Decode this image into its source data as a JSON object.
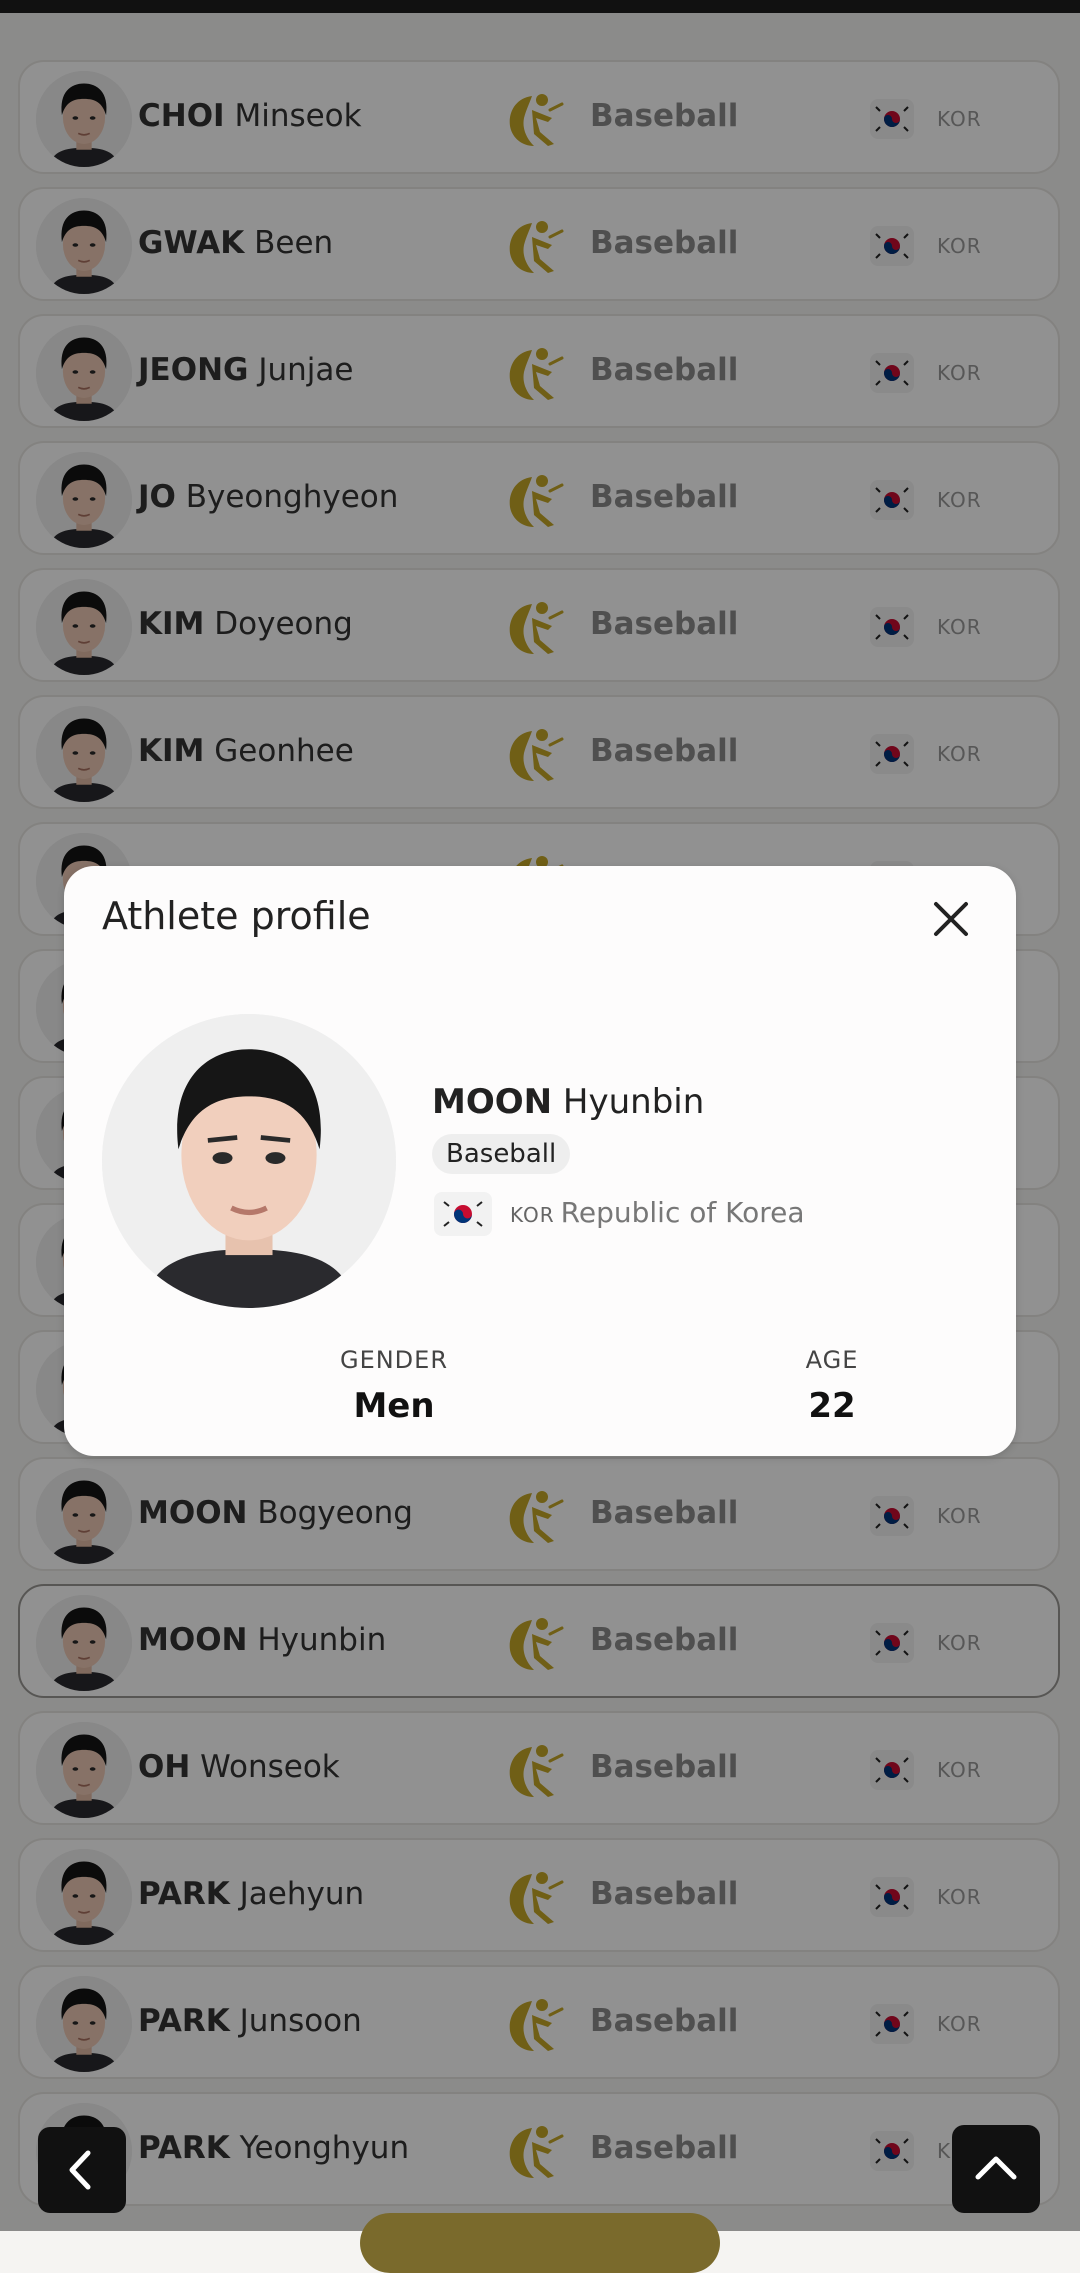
{
  "modal": {
    "title": "Athlete profile",
    "athlete": {
      "family_name": "MOON",
      "given_name": "Hyunbin",
      "sport": "Baseball",
      "noc": "KOR",
      "country": "Republic of Korea"
    },
    "stats": [
      {
        "label": "GENDER",
        "value": "Men"
      },
      {
        "label": "AGE",
        "value": "22"
      }
    ],
    "close_icon": "close-icon"
  },
  "list": {
    "rows": [
      {
        "family": "CHOI",
        "given": "Minseok",
        "sport": "Baseball",
        "noc": "KOR"
      },
      {
        "family": "GWAK",
        "given": "Been",
        "sport": "Baseball",
        "noc": "KOR"
      },
      {
        "family": "JEONG",
        "given": "Junjae",
        "sport": "Baseball",
        "noc": "KOR"
      },
      {
        "family": "JO",
        "given": "Byeonghyeon",
        "sport": "Baseball",
        "noc": "KOR"
      },
      {
        "family": "KIM",
        "given": "Doyeong",
        "sport": "Baseball",
        "noc": "KOR"
      },
      {
        "family": "KIM",
        "given": "Geonhee",
        "sport": "Baseball",
        "noc": "KOR"
      },
      {
        "family": "",
        "given": "",
        "sport": "",
        "noc": ""
      },
      {
        "family": "",
        "given": "",
        "sport": "",
        "noc": ""
      },
      {
        "family": "",
        "given": "",
        "sport": "",
        "noc": ""
      },
      {
        "family": "",
        "given": "",
        "sport": "",
        "noc": ""
      },
      {
        "family": "",
        "given": "",
        "sport": "",
        "noc": ""
      },
      {
        "family": "MOON",
        "given": "Bogyeong",
        "sport": "Baseball",
        "noc": "KOR"
      },
      {
        "family": "MOON",
        "given": "Hyunbin",
        "sport": "Baseball",
        "noc": "KOR",
        "selected": true
      },
      {
        "family": "OH",
        "given": "Wonseok",
        "sport": "Baseball",
        "noc": "KOR"
      },
      {
        "family": "PARK",
        "given": "Jaehyun",
        "sport": "Baseball",
        "noc": "KOR"
      },
      {
        "family": "PARK",
        "given": "Junsoon",
        "sport": "Baseball",
        "noc": "KOR"
      },
      {
        "family": "PARK",
        "given": "Yeonghyun",
        "sport": "Baseball",
        "noc": "K"
      }
    ]
  },
  "buttons": {
    "back_icon": "chevron-left-icon",
    "top_icon": "chevron-up-icon"
  },
  "colors": {
    "sport_gold": "#c6a827",
    "overlay": "rgba(0,0,0,0.43)",
    "modal_bg": "#fdfcfc"
  }
}
